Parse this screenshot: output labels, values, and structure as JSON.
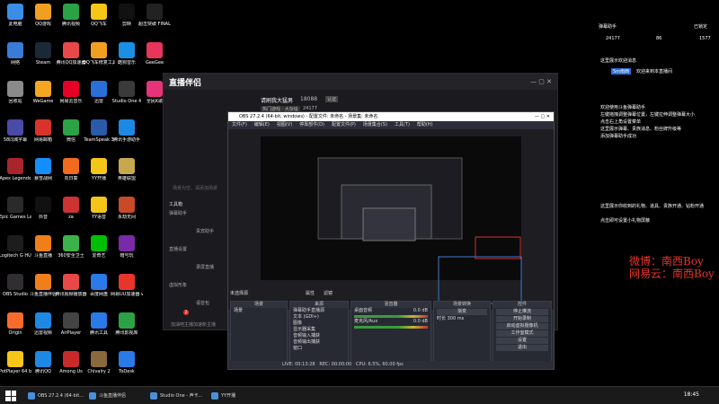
{
  "desktop_icons": [
    {
      "label": "此电脑",
      "color": "#3a8ee6"
    },
    {
      "label": "QQ游戏",
      "color": "#f0a020"
    },
    {
      "label": "腾讯视频",
      "color": "#2ba245"
    },
    {
      "label": "QQ飞车",
      "color": "#f5c518"
    },
    {
      "label": "剪映",
      "color": "#111111"
    },
    {
      "label": "超击突破 FINAL BETA",
      "color": "#222222"
    },
    {
      "label": "网络",
      "color": "#3a7bd5"
    },
    {
      "label": "Steam",
      "color": "#1b2838"
    },
    {
      "label": "腾讯QQ加速器",
      "color": "#e84848"
    },
    {
      "label": "QQ飞车修复工具",
      "color": "#f0a020"
    },
    {
      "label": "酷狗音乐",
      "color": "#1a8fe3"
    },
    {
      "label": "GeeGee",
      "color": "#e8355a"
    },
    {
      "label": "回收站",
      "color": "#8a8a8a"
    },
    {
      "label": "WeGame",
      "color": "#f5a623"
    },
    {
      "label": "网易云音乐",
      "color": "#e60026"
    },
    {
      "label": "迅雷",
      "color": "#2a6fd8"
    },
    {
      "label": "Studio One 4",
      "color": "#3a3a3a"
    },
    {
      "label": "全民K歌",
      "color": "#e6337a"
    },
    {
      "label": "58同城字幕",
      "color": "#4a4aa8"
    },
    {
      "label": "网易邮箱",
      "color": "#d8342c"
    },
    {
      "label": "微信",
      "color": "#2ba245"
    },
    {
      "label": "TeamSpeak 3",
      "color": "#2a5aa8"
    },
    {
      "label": "腾讯手游助手",
      "color": "#1e88e5"
    },
    {
      "label": "",
      "color": "#000000"
    },
    {
      "label": "Apex Legends",
      "color": "#a8262a"
    },
    {
      "label": "暴雪战网",
      "color": "#148eff"
    },
    {
      "label": "向日葵",
      "color": "#f26b1d"
    },
    {
      "label": "YY开播",
      "color": "#f5c518"
    },
    {
      "label": "英雄联盟",
      "color": "#c8a84e"
    },
    {
      "label": "",
      "color": "#000000"
    },
    {
      "label": "Epic Games Launcher",
      "color": "#2a2a2a"
    },
    {
      "label": "抖音",
      "color": "#111111"
    },
    {
      "label": "za",
      "color": "#cc3333"
    },
    {
      "label": "YY语音",
      "color": "#f5c518"
    },
    {
      "label": "永劫无间",
      "color": "#c84a28"
    },
    {
      "label": "",
      "color": "#000000"
    },
    {
      "label": "Logitech G HUB",
      "color": "#1d1d1d"
    },
    {
      "label": "斗鱼直播",
      "color": "#f07f1a"
    },
    {
      "label": "360安全卫士",
      "color": "#3cb34a"
    },
    {
      "label": "爱奇艺",
      "color": "#00be06"
    },
    {
      "label": "暗号玩",
      "color": "#7a2aa8"
    },
    {
      "label": "",
      "color": "#000000"
    },
    {
      "label": "OBS Studio",
      "color": "#302e31"
    },
    {
      "label": "斗鱼直播伴侣",
      "color": "#f07f1a"
    },
    {
      "label": "腾讯视频播放器",
      "color": "#e84848"
    },
    {
      "label": "百度网盘",
      "color": "#2a7ae8"
    },
    {
      "label": "网易UU加速器 v3.2.0",
      "color": "#e8352b"
    },
    {
      "label": "",
      "color": "#000000"
    },
    {
      "label": "Origin",
      "color": "#f56c2d"
    },
    {
      "label": "迅雷视频",
      "color": "#1e88e5"
    },
    {
      "label": "AirPlayer",
      "color": "#444444"
    },
    {
      "label": "腾讯工具",
      "color": "#2a7ae8"
    },
    {
      "label": "腾讯影视库",
      "color": "#2ba245"
    },
    {
      "label": "",
      "color": "#000000"
    },
    {
      "label": "PotPlayer 64 bit",
      "color": "#f5c518"
    },
    {
      "label": "腾讯QQ",
      "color": "#1e88e5"
    },
    {
      "label": "Among Us",
      "color": "#c82a2a"
    },
    {
      "label": "Chivalry 2",
      "color": "#8a6a3a"
    },
    {
      "label": "ToDesk",
      "color": "#2a7ae8"
    },
    {
      "label": "",
      "color": "#000000"
    }
  ],
  "chat": {
    "header": "弹幕助手",
    "pinned": "已锁定",
    "stat_a": "24177",
    "stat_b": "86",
    "stat_c": "1577",
    "line1": "这里展示欢迎消息",
    "line2_badge": "5m南西",
    "line2_text": "欢迎来到本直播间",
    "tip1": "欢迎使用斗鱼弹幕助手",
    "tip2": "左键拖拽调整弹幕位置，左键拉伸调整弹幕大小",
    "tip3": "点击右上角设置菜单",
    "tip4": "这里展示弹幕、贵族消息、粉丝牌升级等",
    "tip5": "添加弹幕助手成功",
    "gift1": "这里展示你收到的礼物、道具、贵族开通、钻粉开通",
    "gift2": "点击即可设置小礼物屏蔽",
    "weibo": "微博：南西Boy",
    "netease": "网易云：南西Boy"
  },
  "zhibo": {
    "logo": "直播伴侣",
    "room_title": "请刷我大猛男",
    "room_id": "18088",
    "tag": "认证",
    "category": "热门游戏 · 大杂烩",
    "count": "24177",
    "tools_header": "工具箱",
    "tool_items": [
      "弹幕助手",
      "贵宾助手",
      "直播设置",
      "录屏直播",
      "虚拟形象",
      "语音包"
    ],
    "promo": "加油吧主播加速新主播",
    "center_hint": "场景为空，请添加场景",
    "badge": "2"
  },
  "obs": {
    "title": "OBS 27.2.4 (64-bit, windows) - 配置文件: 未命名 - 场景集: 未命名",
    "menus": [
      "文件(F)",
      "编辑(E)",
      "视图(V)",
      "停靠部件(D)",
      "配置文件(P)",
      "场景集合(S)",
      "工具(T)",
      "帮助(H)"
    ],
    "scene_label": "未选择源",
    "scene_props": "属性",
    "scene_filters": "滤镜",
    "docks": {
      "scenes": {
        "title": "场景",
        "items": [
          "场景"
        ]
      },
      "sources": {
        "title": "来源",
        "items": [
          "弹幕助手直播源",
          "文本 (GDI+)",
          "图像",
          "显示器采集",
          "音频输入捕获",
          "音频输出捕获",
          "窗口"
        ]
      },
      "mixer": {
        "title": "混音器",
        "track1": "桌面音频",
        "track2": "麦克风/Aux",
        "db1": "0.0 dB",
        "db2": "0.0 dB"
      },
      "transitions": {
        "title": "场景转换",
        "mode": "渐变",
        "duration_label": "时长",
        "duration": "300 ms"
      },
      "controls": {
        "title": "控件",
        "buttons": [
          "停止推流",
          "开始录制",
          "启动虚拟摄像机",
          "工作室模式",
          "设置",
          "退出"
        ]
      }
    },
    "status": {
      "live": "LIVE: 00:13:28",
      "rec": "REC: 00:00:00",
      "cpu": "CPU: 6.5%, 60.00 fps"
    }
  },
  "taskbar": {
    "apps": [
      "OBS 27.2.4 (64-bit...",
      "斗鱼直播伴侣",
      "Studio One - 声卡...",
      "YY开播"
    ],
    "clock": "18:45"
  }
}
